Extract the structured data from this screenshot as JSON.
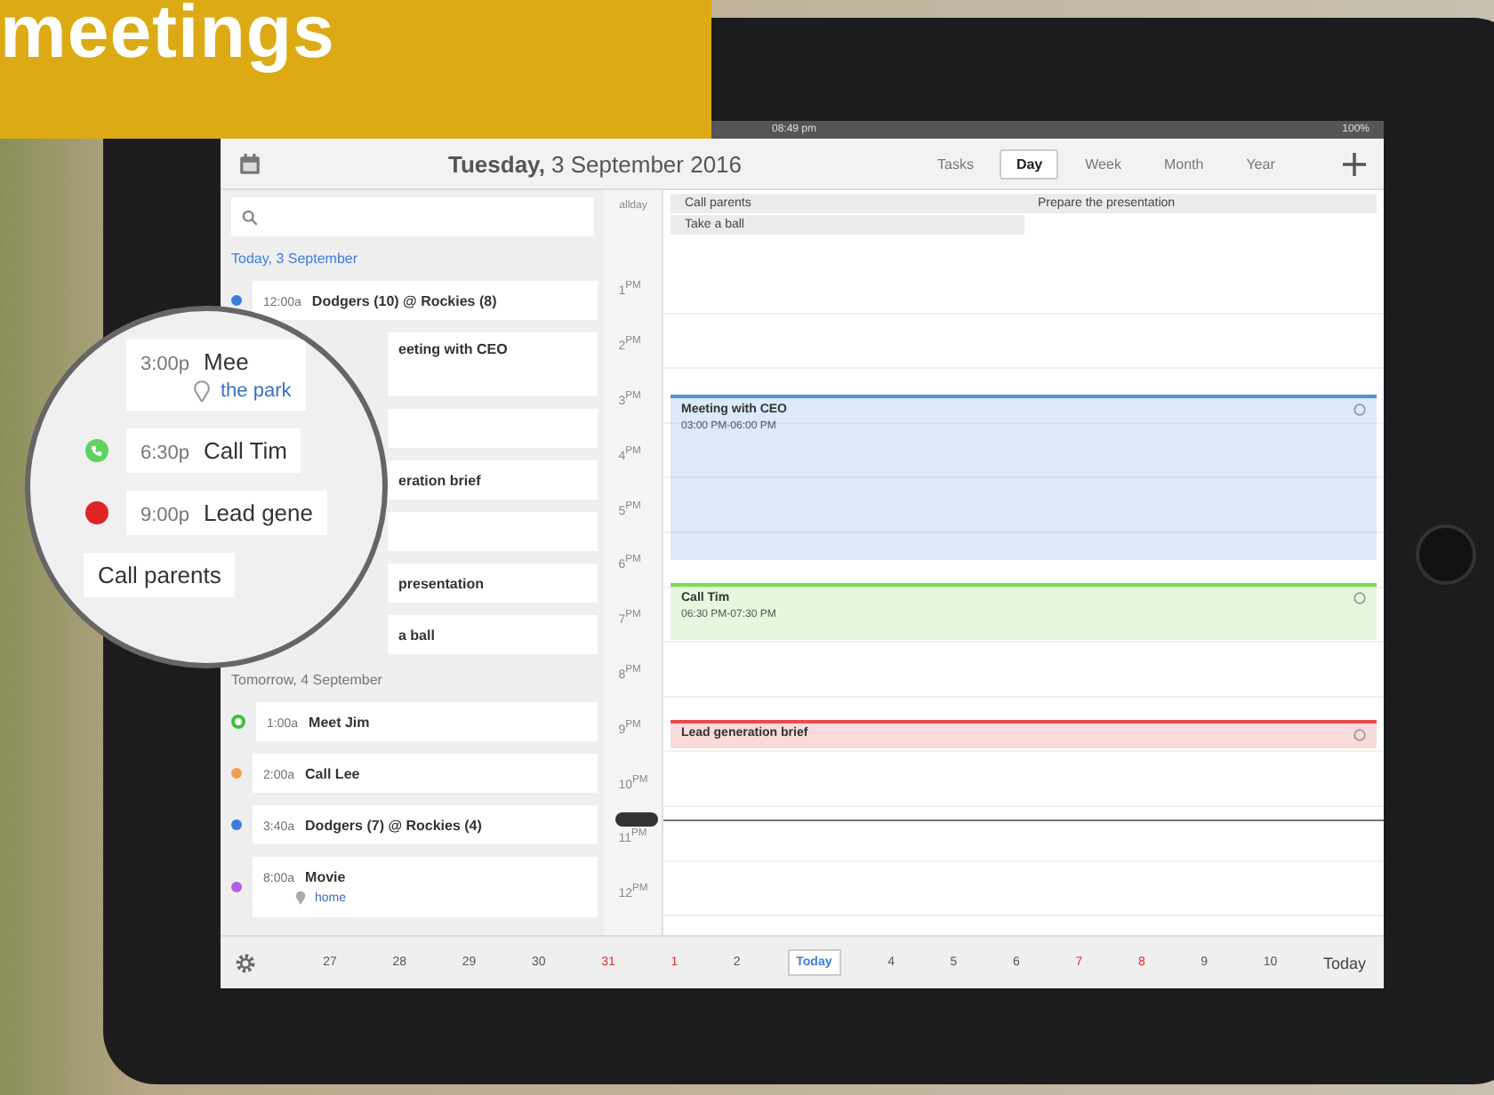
{
  "banner": {
    "text": "meetings"
  },
  "status_bar": {
    "time": "08:49 pm",
    "battery": "100%"
  },
  "header": {
    "title": "**Tuesday,** 3 September 2016"
  },
  "tabs": [
    {
      "label": "Tasks",
      "selected": false
    },
    {
      "label": "Day",
      "selected": true
    },
    {
      "label": "Week",
      "selected": false
    },
    {
      "label": "Month",
      "selected": false
    },
    {
      "label": "Year",
      "selected": false
    }
  ],
  "agenda": [
    {
      "heading": "Today, 3 September",
      "today": true,
      "items": [
        {
          "kind": "event",
          "time": "12:00a",
          "title": "Dodgers (10) @ Rockies (8)",
          "color": "#3b7de0"
        },
        {
          "kind": "covered",
          "text": "eeting with CEO",
          "tall": true
        },
        {
          "kind": "blank"
        },
        {
          "kind": "covered",
          "text": "eration brief"
        },
        {
          "kind": "blank"
        },
        {
          "kind": "covered",
          "text": "presentation"
        },
        {
          "kind": "covered",
          "text": "a ball"
        }
      ]
    },
    {
      "heading": "Tomorrow, 4 September",
      "today": false,
      "items": [
        {
          "kind": "event",
          "time": "1:00a",
          "title": "Meet Jim",
          "color": "#3fbf3f",
          "ring": true
        },
        {
          "kind": "event",
          "time": "2:00a",
          "title": "Call Lee",
          "color": "#f0a050"
        },
        {
          "kind": "event",
          "time": "3:40a",
          "title": "Dodgers (7) @ Rockies (4)",
          "color": "#3b7de0"
        },
        {
          "kind": "event",
          "time": "8:00a",
          "title": "Movie",
          "color": "#b060e0",
          "location": "home"
        }
      ]
    }
  ],
  "hours": {
    "allday": "allday",
    "labels": [
      "1$^{PM}$",
      "2$^{PM}$",
      "3$^{PM}$",
      "4$^{PM}$",
      "5$^{PM}$",
      "6$^{PM}$",
      "7$^{PM}$",
      "8$^{PM}$",
      "9$^{PM}$",
      "10$^{PM}$",
      "11$^{PM}$",
      "12$^{PM}$"
    ]
  },
  "allday_tasks": [
    {
      "title": "Call parents"
    },
    {
      "title": "Prepare the presentation"
    },
    {
      "title": "Take a ball"
    }
  ],
  "events": [
    {
      "title": "Meeting with CEO",
      "times": "03:00 PM-06:00 PM",
      "color": "#4a90e2"
    },
    {
      "title": "Call Tim",
      "times": "06:30 PM-07:30 PM",
      "color": "#7ed957"
    },
    {
      "title": "Lead generation brief",
      "color": "#e84b4b"
    }
  ],
  "date_strip": [
    {
      "label": "27",
      "weekend": false,
      "selected": false
    },
    {
      "label": "28",
      "weekend": false,
      "selected": false
    },
    {
      "label": "29",
      "weekend": false,
      "selected": false
    },
    {
      "label": "30",
      "weekend": false,
      "selected": false
    },
    {
      "label": "31",
      "weekend": true,
      "selected": false
    },
    {
      "label": "1",
      "weekend": true,
      "selected": false
    },
    {
      "label": "2",
      "weekend": false,
      "selected": false
    },
    {
      "label": "Today",
      "weekend": false,
      "selected": true
    },
    {
      "label": "4",
      "weekend": false,
      "selected": false
    },
    {
      "label": "5",
      "weekend": false,
      "selected": false
    },
    {
      "label": "6",
      "weekend": false,
      "selected": false
    },
    {
      "label": "7",
      "weekend": true,
      "selected": false
    },
    {
      "label": "8",
      "weekend": true,
      "selected": false
    },
    {
      "label": "9",
      "weekend": false,
      "selected": false
    },
    {
      "label": "10",
      "weekend": false,
      "selected": false
    }
  ],
  "today_button": "Today",
  "magnifier": {
    "rows": [
      {
        "kind": "event",
        "time": "3:00p",
        "title": "Mee",
        "location": "the park"
      },
      {
        "kind": "call",
        "time": "6:30p",
        "title": "Call Tim",
        "color": "#5fd35f"
      },
      {
        "kind": "event",
        "time": "9:00p",
        "title": "Lead gene",
        "color": "#e02424"
      },
      {
        "kind": "task",
        "title": "Call parents"
      }
    ]
  }
}
